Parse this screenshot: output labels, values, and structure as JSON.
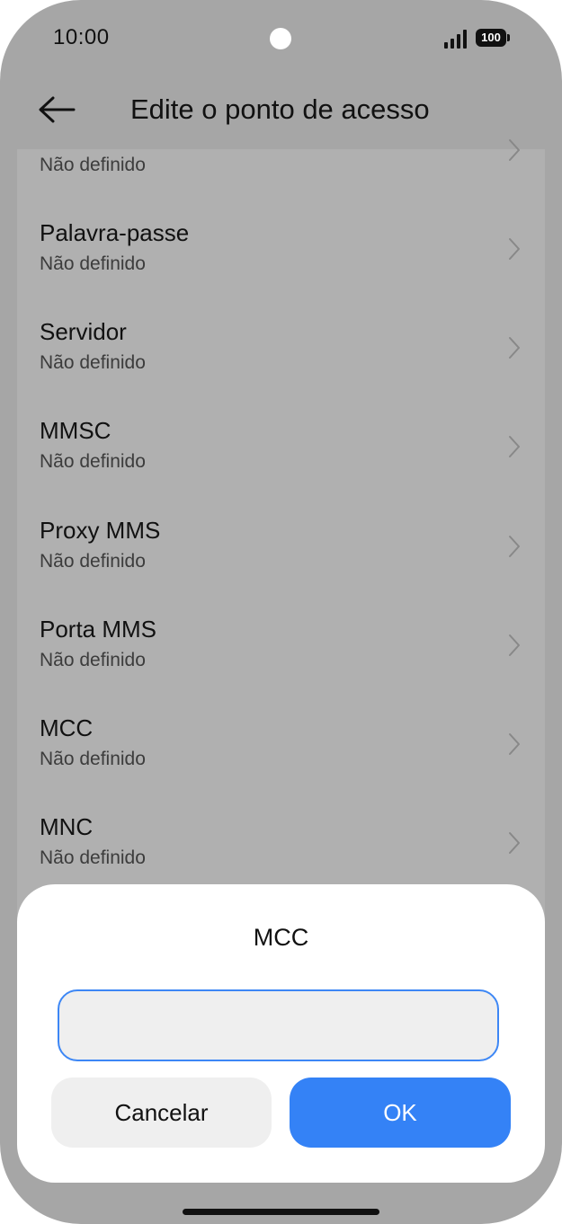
{
  "status_bar": {
    "time": "10:00",
    "battery": "100",
    "signal_icon": "signal-strength-icon"
  },
  "header": {
    "title": "Edite o ponto de acesso",
    "back_icon": "arrow-left-icon"
  },
  "settings_list": {
    "items": [
      {
        "title": "",
        "value": "Não definido"
      },
      {
        "title": "Palavra-passe",
        "value": "Não definido"
      },
      {
        "title": "Servidor",
        "value": "Não definido"
      },
      {
        "title": "MMSC",
        "value": "Não definido"
      },
      {
        "title": "Proxy MMS",
        "value": "Não definido"
      },
      {
        "title": "Porta MMS",
        "value": "Não definido"
      },
      {
        "title": "MCC",
        "value": "Não definido"
      },
      {
        "title": "MNC",
        "value": "Não definido"
      }
    ],
    "chevron_icon": "chevron-right-icon"
  },
  "dialog": {
    "title": "MCC",
    "input_value": "",
    "cancel_label": "Cancelar",
    "ok_label": "OK"
  },
  "colors": {
    "accent": "#3482f6",
    "overlay": "#a6a6a6",
    "dialog_bg": "#ffffff",
    "input_bg": "#efefef"
  }
}
